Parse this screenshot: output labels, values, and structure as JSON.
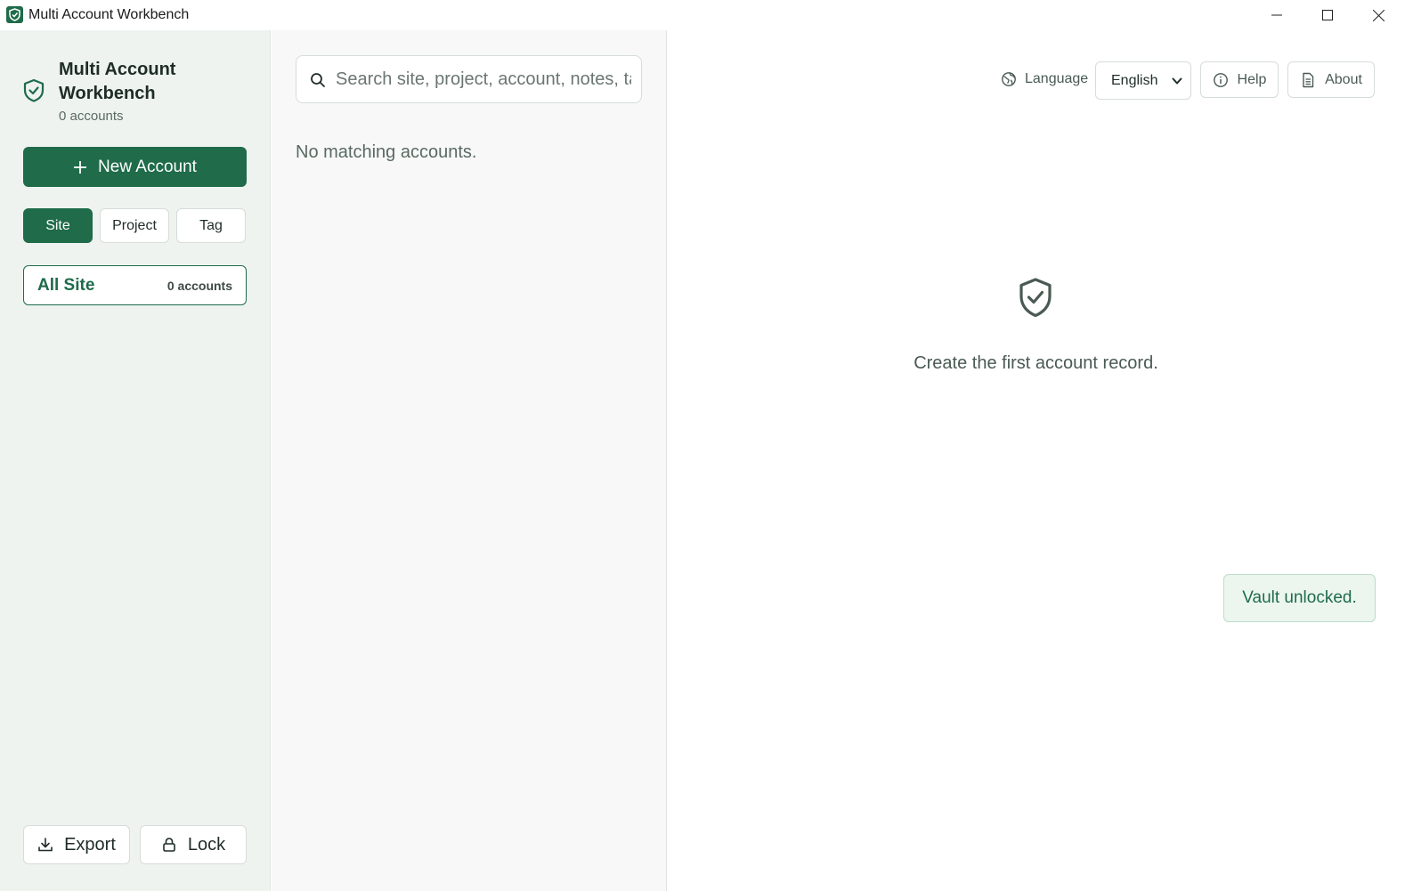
{
  "window": {
    "title": "Multi Account Workbench",
    "controls": [
      "minimize",
      "maximize",
      "close"
    ]
  },
  "sidebar": {
    "brand_title": "Multi Account Workbench",
    "account_count": "0 accounts",
    "new_account_label": "New Account",
    "group_tabs": [
      {
        "label": "Site",
        "active": true
      },
      {
        "label": "Project",
        "active": false
      },
      {
        "label": "Tag",
        "active": false
      }
    ],
    "groups": [
      {
        "name": "All Site",
        "count": "0 accounts",
        "selected": true
      }
    ],
    "export_label": "Export",
    "lock_label": "Lock"
  },
  "list": {
    "search_placeholder": "Search site, project, account, notes, ta",
    "search_value": "",
    "empty_message": "No matching accounts."
  },
  "detail": {
    "language_label": "Language",
    "language_value": "English",
    "language_options": [
      "English"
    ],
    "help_label": "Help",
    "about_label": "About",
    "empty_message": "Create the first account record.",
    "toast": "Vault unlocked."
  },
  "colors": {
    "accent": "#1f6b4a",
    "sidebar_bg": "#eef3f0",
    "list_bg": "#f7f8f7",
    "toast_bg": "#ecf6ef"
  },
  "icons": [
    "app-shield-icon",
    "minimize-icon",
    "maximize-icon",
    "close-icon",
    "shield-check-icon",
    "plus-icon",
    "download-icon",
    "lock-icon",
    "search-icon",
    "globe-icon",
    "chevron-down-icon",
    "info-icon",
    "document-icon"
  ]
}
